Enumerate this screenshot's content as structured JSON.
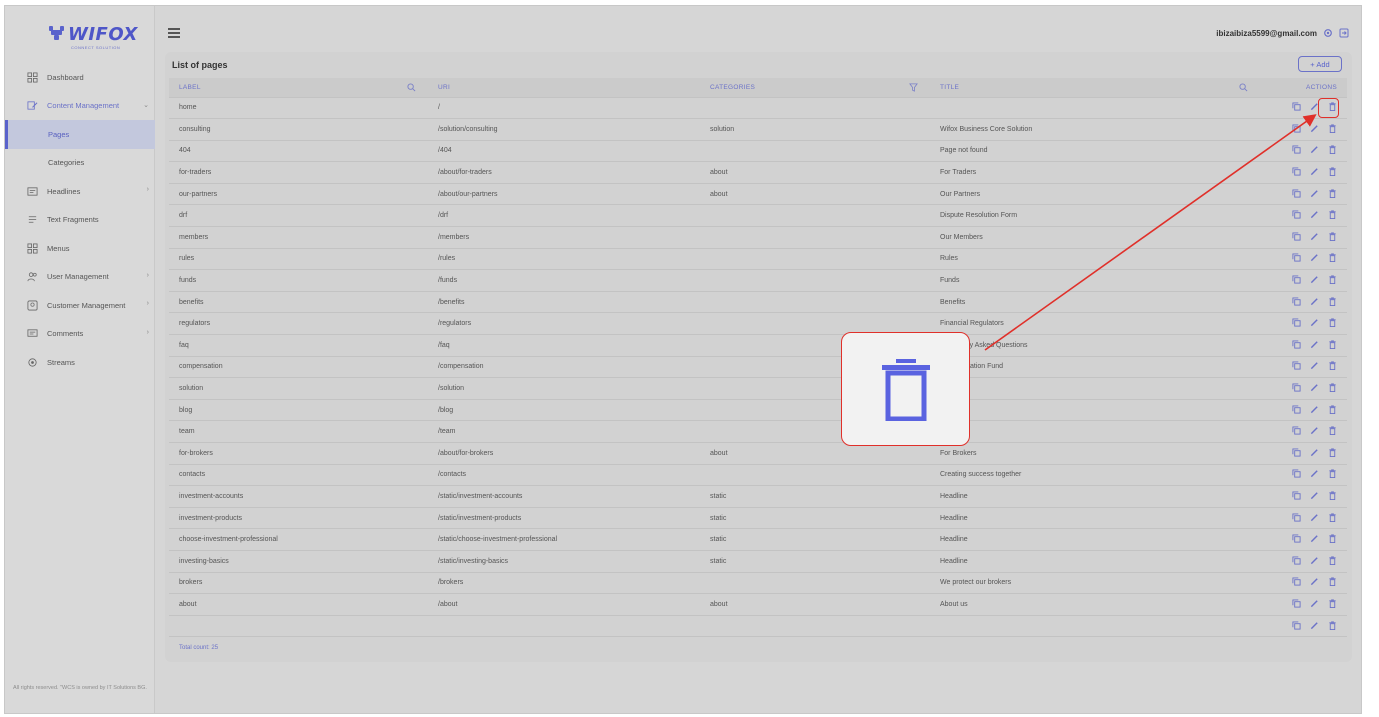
{
  "brand": {
    "name": "WIFOX",
    "tagline": "CONNECT SOLUTION"
  },
  "sidebar": {
    "items": [
      {
        "label": "Dashboard",
        "icon": "dashboard-icon",
        "chevron": ""
      },
      {
        "label": "Content Management",
        "icon": "content-management-icon",
        "chevron": "⌄",
        "active": true
      },
      {
        "label": "Headlines",
        "icon": "headlines-icon",
        "chevron": "›"
      },
      {
        "label": "Text Fragments",
        "icon": "text-fragments-icon",
        "chevron": ""
      },
      {
        "label": "Menus",
        "icon": "menus-icon",
        "chevron": ""
      },
      {
        "label": "User Management",
        "icon": "user-management-icon",
        "chevron": "›"
      },
      {
        "label": "Customer Management",
        "icon": "customer-management-icon",
        "chevron": "›"
      },
      {
        "label": "Comments",
        "icon": "comments-icon",
        "chevron": "›"
      },
      {
        "label": "Streams",
        "icon": "streams-icon",
        "chevron": ""
      }
    ],
    "subitems": [
      {
        "label": "Pages",
        "active": true
      },
      {
        "label": "Categories",
        "active": false
      }
    ],
    "footer": "All rights reserved. \"WCS is owned by IT Solutions BG."
  },
  "header": {
    "user_email": "ibizaibiza5599@gmail.com"
  },
  "page": {
    "title": "List of pages",
    "add_label": "+ Add",
    "columns": {
      "label": "LABEL",
      "uri": "URI",
      "categories": "CATEGORIES",
      "title": "TITLE",
      "actions": "ACTIONS"
    },
    "rows": [
      {
        "label": "home",
        "uri": "/",
        "categories": "",
        "title": ""
      },
      {
        "label": "consulting",
        "uri": "/solution/consulting",
        "categories": "solution",
        "title": "Wifox Business Core Solution"
      },
      {
        "label": "404",
        "uri": "/404",
        "categories": "",
        "title": "Page not found"
      },
      {
        "label": "for-traders",
        "uri": "/about/for-traders",
        "categories": "about",
        "title": "For Traders"
      },
      {
        "label": "our-partners",
        "uri": "/about/our-partners",
        "categories": "about",
        "title": "Our Partners"
      },
      {
        "label": "drf",
        "uri": "/drf",
        "categories": "",
        "title": "Dispute Resolution Form"
      },
      {
        "label": "members",
        "uri": "/members",
        "categories": "",
        "title": "Our Members"
      },
      {
        "label": "rules",
        "uri": "/rules",
        "categories": "",
        "title": "Rules"
      },
      {
        "label": "funds",
        "uri": "/funds",
        "categories": "",
        "title": "Funds"
      },
      {
        "label": "benefits",
        "uri": "/benefits",
        "categories": "",
        "title": "Benefits"
      },
      {
        "label": "regulators",
        "uri": "/regulators",
        "categories": "",
        "title": "Financial Regulators"
      },
      {
        "label": "faq",
        "uri": "/faq",
        "categories": "",
        "title": "Frequently Asked Questions"
      },
      {
        "label": "compensation",
        "uri": "/compensation",
        "categories": "",
        "title": "Compensation Fund"
      },
      {
        "label": "solution",
        "uri": "/solution",
        "categories": "",
        "title": ""
      },
      {
        "label": "blog",
        "uri": "/blog",
        "categories": "",
        "title": ""
      },
      {
        "label": "team",
        "uri": "/team",
        "categories": "",
        "title": ""
      },
      {
        "label": "for-brokers",
        "uri": "/about/for-brokers",
        "categories": "about",
        "title": "For Brokers"
      },
      {
        "label": "contacts",
        "uri": "/contacts",
        "categories": "",
        "title": "Creating success together"
      },
      {
        "label": "investment-accounts",
        "uri": "/static/investment-accounts",
        "categories": "static",
        "title": "Headline"
      },
      {
        "label": "investment-products",
        "uri": "/static/investment-products",
        "categories": "static",
        "title": "Headline"
      },
      {
        "label": "choose-investment-professional",
        "uri": "/static/choose-investment-professional",
        "categories": "static",
        "title": "Headline"
      },
      {
        "label": "investing-basics",
        "uri": "/static/investing-basics",
        "categories": "static",
        "title": "Headline"
      },
      {
        "label": "brokers",
        "uri": "/brokers",
        "categories": "",
        "title": "We protect our brokers"
      },
      {
        "label": "about",
        "uri": "/about",
        "categories": "about",
        "title": "About us"
      },
      {
        "label": "",
        "uri": "",
        "categories": "",
        "title": ""
      }
    ],
    "total_count": "Total count: 25"
  },
  "colors": {
    "accent": "#5a63cc",
    "highlight": "#e0302a",
    "background": "#d6d6d6"
  }
}
